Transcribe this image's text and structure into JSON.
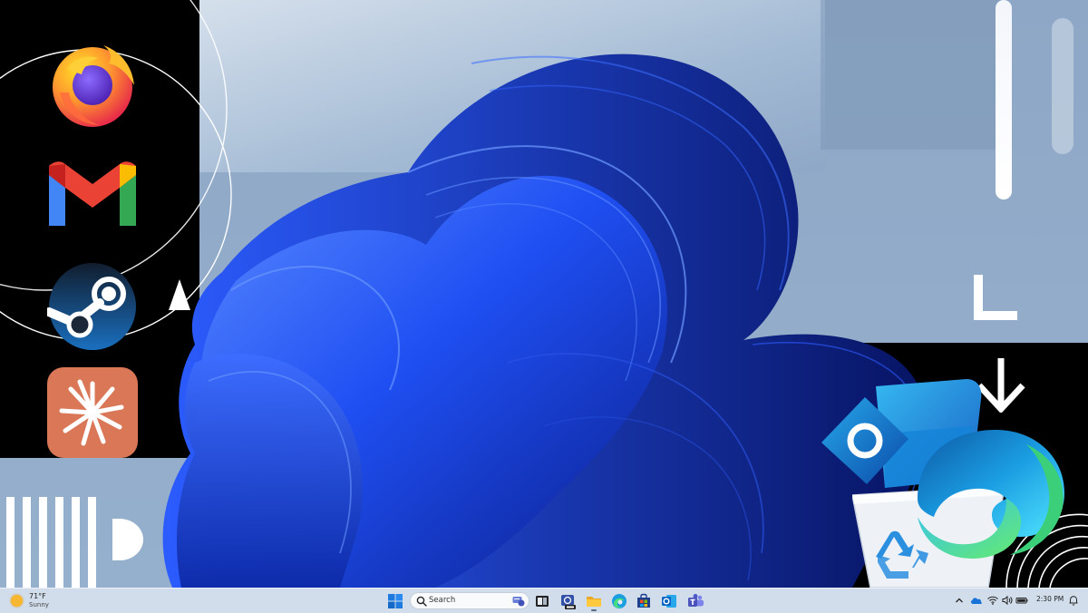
{
  "taskbar": {
    "weather": {
      "temperature": "71°F",
      "condition": "Sunny"
    },
    "search": {
      "label": "Search"
    },
    "clock": {
      "time": "2:30 PM"
    }
  },
  "dock_apps": [
    "firefox-icon",
    "gmail-icon",
    "steam-icon",
    "claude-icon"
  ],
  "taskbar_apps": [
    "start-icon",
    "search-icon",
    "task-view-icon",
    "zoomit-icon",
    "file-explorer-icon",
    "edge-icon",
    "microsoft-store-icon",
    "outlook-icon",
    "teams-icon"
  ],
  "tray_icons": [
    "chevron-up-icon",
    "onedrive-icon",
    "wifi-icon",
    "volume-icon",
    "battery-icon",
    "notifications-icon"
  ],
  "desktop_icons": [
    "outlook-icon",
    "edge-icon",
    "recycle-bin-icon"
  ],
  "colors": {
    "accent": "#1a4cf0",
    "taskbar": "#d7e2ee",
    "dock": "#000000",
    "firefox": "#ff7139",
    "gmail_red": "#ea4335",
    "steam": "#1b2838",
    "claude": "#d97757"
  }
}
